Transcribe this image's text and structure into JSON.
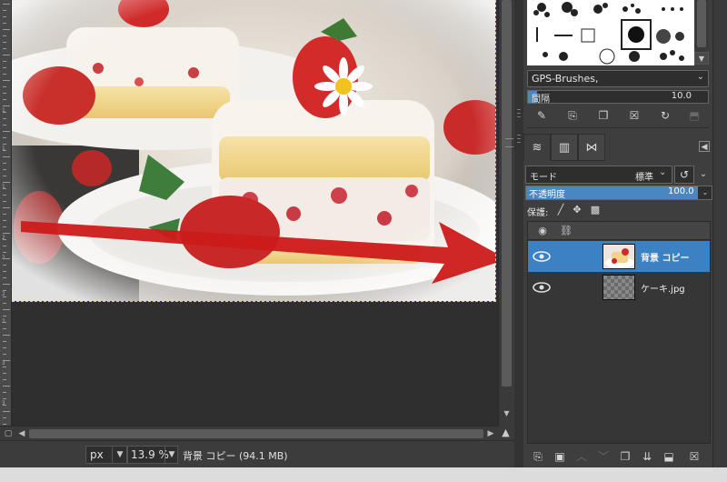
{
  "status": {
    "unit": "px",
    "zoom": "13.9 %",
    "info": "背景 コピー (94.1 MB)"
  },
  "canvas": {
    "image_description_icon": "cake-photo",
    "arrow_color": "#cc1a1a"
  },
  "ruler": {
    "labels": [
      "1",
      "1",
      "1",
      "2",
      "2",
      "2",
      "2",
      "3",
      "3"
    ]
  },
  "brushes": {
    "selected": "GPS-Brushes,",
    "spacing_label": "間隔",
    "spacing_value": "10.0",
    "spacing_fraction": 0.05
  },
  "brush_tools": [
    "edit-brush-icon",
    "new-brush-icon",
    "duplicate-brush-icon",
    "delete-brush-icon",
    "refresh-brush-icon",
    "export-brush-icon"
  ],
  "tabs": [
    "layers-tab",
    "channels-tab",
    "paths-tab"
  ],
  "layers_panel": {
    "mode_label": "モード",
    "mode_value": "標準",
    "opacity_label": "不透明度",
    "opacity_value": "100.0",
    "opacity_fraction": 1.0,
    "lock_label": "保護:",
    "layers": [
      {
        "name": "背景 コピー",
        "selected": true
      },
      {
        "name": "ケーキ.jpg",
        "selected": false
      }
    ]
  },
  "colors": {
    "accent": "#3b82c4",
    "selection_dash": "#e6d54a"
  }
}
